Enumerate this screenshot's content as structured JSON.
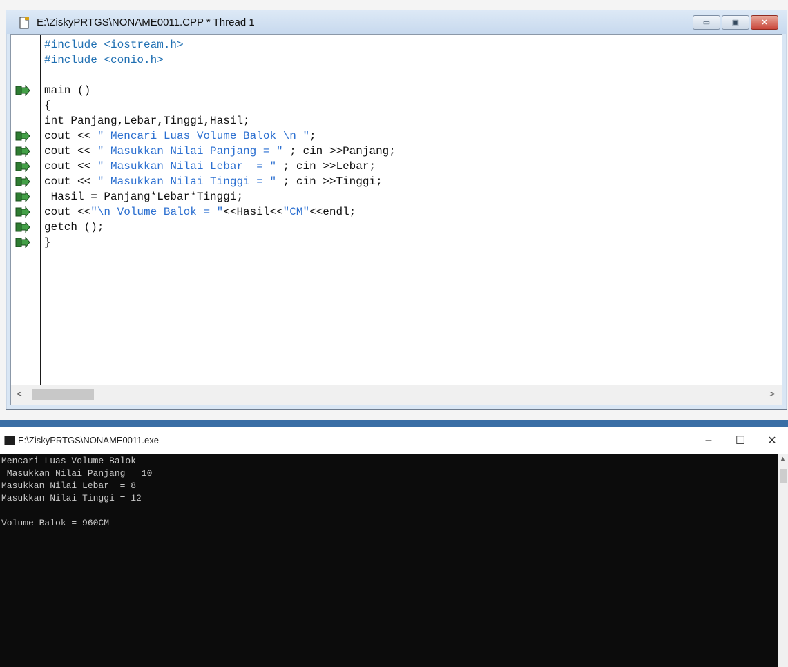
{
  "editor": {
    "title": "E:\\ZiskyPRTGS\\NONAME0011.CPP * Thread 1",
    "icons": {
      "document": "document-icon",
      "breakpoint": "execution-arrow-icon"
    },
    "buttons": {
      "minimize": "▭",
      "maximize": "▣",
      "close": "✕"
    },
    "code": [
      {
        "text": "#include <iostream.h>",
        "kind": "preprocessor",
        "marker": false
      },
      {
        "text": "#include <conio.h>",
        "kind": "preprocessor",
        "marker": false
      },
      {
        "text": "",
        "kind": "plain",
        "marker": false
      },
      {
        "text": "main ()",
        "kind": "plain",
        "marker": true
      },
      {
        "text": "{",
        "kind": "plain",
        "marker": false
      },
      {
        "text": "int Panjang,Lebar,Tinggi,Hasil;",
        "kind": "plain",
        "marker": false
      },
      {
        "text": "cout << \" Mencari Luas Volume Balok \\n \";",
        "kind": "mixed",
        "marker": true
      },
      {
        "text": "cout << \" Masukkan Nilai Panjang = \" ; cin >>Panjang;",
        "kind": "mixed",
        "marker": true
      },
      {
        "text": "cout << \" Masukkan Nilai Lebar  = \" ; cin >>Lebar;",
        "kind": "mixed",
        "marker": true
      },
      {
        "text": "cout << \" Masukkan Nilai Tinggi = \" ; cin >>Tinggi;",
        "kind": "mixed",
        "marker": true
      },
      {
        "text": " Hasil = Panjang*Lebar*Tinggi;",
        "kind": "plain",
        "marker": true
      },
      {
        "text": "cout <<\"\\n Volume Balok = \"<<Hasil<<\"CM\"<<endl;",
        "kind": "mixed",
        "marker": true
      },
      {
        "text": "getch ();",
        "kind": "plain",
        "marker": true
      },
      {
        "text": "}",
        "kind": "plain",
        "marker": true
      }
    ],
    "scroll": {
      "left": "<",
      "right": ">"
    }
  },
  "console": {
    "title": "E:\\ZiskyPRTGS\\NONAME0011.exe",
    "buttons": {
      "minimize": "–",
      "maximize": "☐",
      "close": "✕"
    },
    "output": [
      "Mencari Luas Volume Balok",
      " Masukkan Nilai Panjang = 10",
      "Masukkan Nilai Lebar  = 8",
      "Masukkan Nilai Tinggi = 12",
      "",
      "Volume Balok = 960CM"
    ],
    "scroll_up": "▲"
  },
  "colors": {
    "preprocessor": "#1f6fb2",
    "string": "#2b6fd0",
    "code_text": "#111111",
    "console_bg": "#0c0c0c",
    "console_text": "#c8c8c8"
  }
}
